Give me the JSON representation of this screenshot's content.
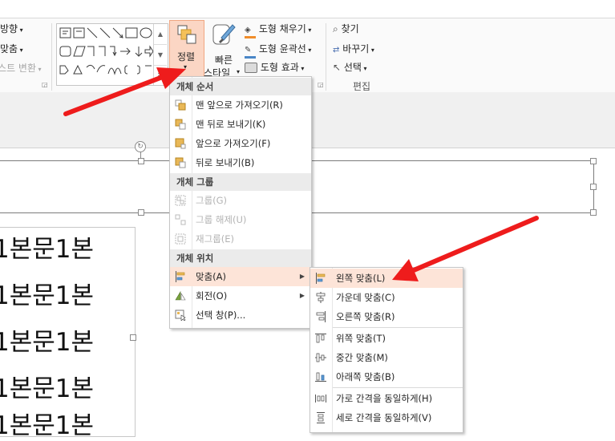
{
  "ribbon": {
    "left_partial": [
      "방향",
      "맞춤",
      "텍스트 변환"
    ],
    "arrange_label": "정렬",
    "quick_style_label_1": "빠른",
    "quick_style_label_2": "스타일",
    "shape_fill": "도형 채우기",
    "shape_outline": "도형 윤곽선",
    "shape_effects": "도형 효과",
    "find": "찾기",
    "replace": "바꾸기",
    "select": "선택",
    "edit_group": "편집"
  },
  "slide": {
    "body_lines": [
      "1본문1본",
      "1본문1본",
      "1본문1본",
      "1본문1본",
      "1본문1본"
    ]
  },
  "arrange_menu": {
    "header_order": "개체 순서",
    "bring_to_front": "맨 앞으로 가져오기(R)",
    "send_to_back": "맨 뒤로 보내기(K)",
    "bring_forward": "앞으로 가져오기(F)",
    "send_backward": "뒤로 보내기(B)",
    "header_group": "개체 그룹",
    "group": "그룹(G)",
    "ungroup": "그룹 해제(U)",
    "regroup": "재그룹(E)",
    "header_position": "개체 위치",
    "align": "맞춤(A)",
    "rotate": "회전(O)",
    "selection_pane": "선택 창(P)..."
  },
  "align_menu": {
    "align_left": "왼쪽 맞춤(L)",
    "align_center": "가운데 맞춤(C)",
    "align_right": "오른쪽 맞춤(R)",
    "align_top": "위쪽 맞춤(T)",
    "align_middle": "중간 맞춤(M)",
    "align_bottom": "아래쪽 맞춤(B)",
    "distribute_horizontal": "가로 간격을 동일하게(H)",
    "distribute_vertical": "세로 간격을 동일하게(V)"
  },
  "colors": {
    "highlight": "#fde4d8",
    "arrow": "#ee1c1c",
    "menu_header_bg": "#ebebeb"
  }
}
